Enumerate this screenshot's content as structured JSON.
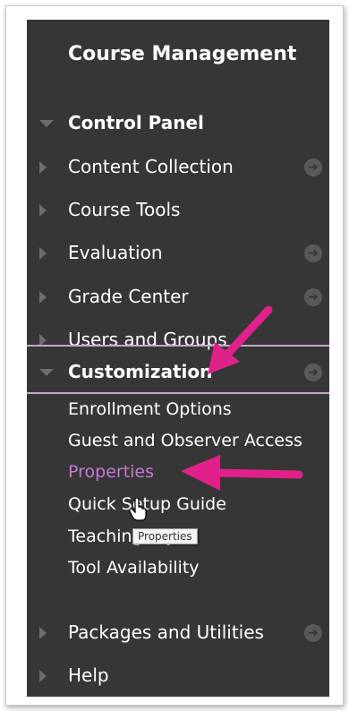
{
  "panel": {
    "title": "Course Management",
    "sections": [
      {
        "label": "Control Panel",
        "expanded": true,
        "bold": true
      },
      {
        "label": "Content Collection",
        "action_icon": "arrow-circle-icon"
      },
      {
        "label": "Course Tools"
      },
      {
        "label": "Evaluation",
        "action_icon": "arrow-circle-icon"
      },
      {
        "label": "Grade Center",
        "action_icon": "arrow-circle-icon"
      },
      {
        "label": "Users and Groups"
      },
      {
        "label": "Customization",
        "expanded": true,
        "bold": true,
        "action_icon": "arrow-circle-icon"
      }
    ],
    "customization_items": [
      {
        "label": "Enrollment Options"
      },
      {
        "label": "Guest and Observer Access"
      },
      {
        "label": "Properties",
        "hovered": true
      },
      {
        "label": "Quick Setup Guide"
      },
      {
        "label": "Teaching Style"
      },
      {
        "label": "Tool Availability"
      }
    ],
    "footer_sections": [
      {
        "label": "Packages and Utilities",
        "action_icon": "arrow-circle-icon"
      },
      {
        "label": "Help"
      }
    ],
    "tooltip": "Properties"
  },
  "colors": {
    "panel_bg": "#363636",
    "hover_text": "#c27ad6",
    "annotation_arrow": "#e0218a",
    "divider": "#c7a6cf"
  }
}
